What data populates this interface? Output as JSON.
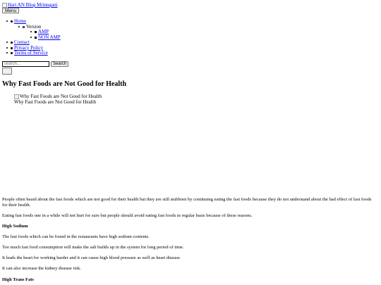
{
  "site": {
    "logo_alt": "Hari AN Blog Mrinngani",
    "menu_label": "Menu"
  },
  "nav": {
    "home": "Home",
    "version": "Version",
    "amp": "AMP",
    "non_amp": "NON AMP",
    "contact": "Contact",
    "privacy": "Privacy Policy",
    "terms": "Terms of Service"
  },
  "search": {
    "placeholder": "search...",
    "button_label": "Search"
  },
  "article": {
    "title": "Why Fast Foods are Not Good for Health",
    "image_alt": "Why Fast Foods are Not Good for Health",
    "image_caption": "Why Fast Foods are Not Good for Health",
    "intro": "People often heard about the fast foods which are not good for their health but they are still stubborn by continuing eating the fast foods because they do not understand about the bad effect of fast foods for their health.",
    "p2": "Eating fast foods one in a while will not hurt for sure but people should avoid eating fast foods in regular basis because of these reasons.",
    "h_sodium": "High Sodium",
    "p3": "The fast foods which can be found in the restaurants have high sodium contents.",
    "p4": "Too much fast food consumption will make the salt builds up in the system for long period of time.",
    "p5": "It leads the heart for working harder and it can cause high blood pressure as well as heart disease.",
    "p6": "It can also increase the kidney disease risk.",
    "h_trans": "High Trans Fats"
  }
}
